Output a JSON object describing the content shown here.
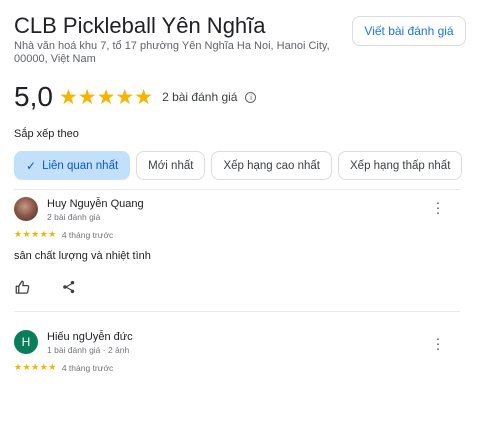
{
  "place": {
    "title": "CLB Pickleball Yên Nghĩa",
    "address": "Nhà văn hoá khu 7, tổ 17 phường Yên Nghĩa Ha Noi, Hanoi City, 00000, Việt Nam"
  },
  "header": {
    "write_review_label": "Viết bài đánh giá"
  },
  "summary": {
    "score": "5,0",
    "stars": "★★★★★",
    "rating": 5,
    "count_label": "2 bài đánh giá",
    "info_icon": "i"
  },
  "sort": {
    "label": "Sắp xếp theo",
    "chips": [
      {
        "label": "Liên quan nhất",
        "active": true
      },
      {
        "label": "Mới nhất",
        "active": false
      },
      {
        "label": "Xếp hạng cao nhất",
        "active": false
      },
      {
        "label": "Xếp hạng thấp nhất",
        "active": false
      }
    ],
    "check_icon": "✓"
  },
  "reviews": [
    {
      "name": "Huy Nguyễn Quang",
      "meta": "2 bài đánh giá",
      "stars": "★★★★★",
      "rating": 5,
      "time": "4 tháng trước",
      "text": "sân chất lượng và nhiệt tình",
      "avatar": "photo"
    },
    {
      "name": "Hiếu ngUyễn đức",
      "meta": "1 bài đánh giá · 2 ảnh",
      "stars": "★★★★★",
      "rating": 5,
      "time": "4 tháng trước",
      "text": "",
      "avatar_letter": "H",
      "avatar_color": "#0a7d5a"
    }
  ],
  "icons": {
    "more": "more-vert-icon",
    "like": "thumb-up-icon",
    "share": "share-icon"
  },
  "colors": {
    "star": "#f6b400",
    "accent": "#1a73e8",
    "active_chip_bg": "#c2e0fa"
  }
}
